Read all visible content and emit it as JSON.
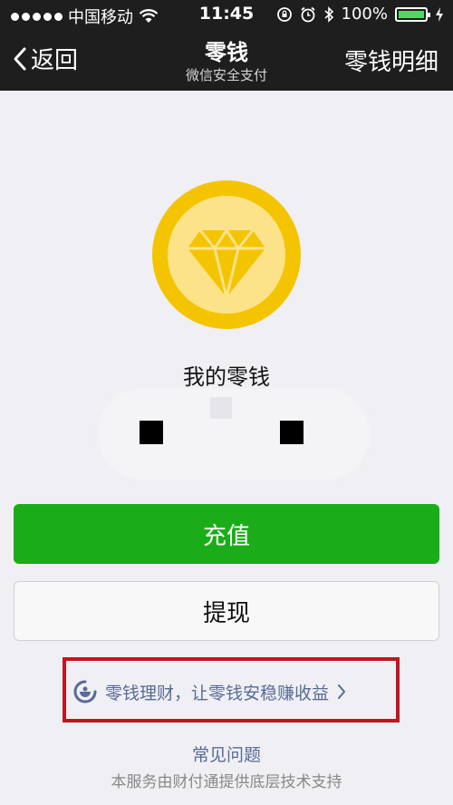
{
  "status_bar": {
    "carrier": "中国移动",
    "time": "11:45",
    "battery": "100%",
    "battery_level": 1.0
  },
  "nav": {
    "back_label": "返回",
    "title": "零钱",
    "subtitle": "微信安全支付",
    "details_label": "零钱明细"
  },
  "wallet": {
    "balance_label": "我的零钱"
  },
  "actions": {
    "recharge_label": "充值",
    "withdraw_label": "提现"
  },
  "promo": {
    "text": "零钱理财，让零钱安稳赚收益"
  },
  "footer": {
    "faq_label": "常见问题",
    "note": "本服务由财付通提供底层技术支持"
  },
  "colors": {
    "primary_green": "#1aad19",
    "link_blue": "#576b95",
    "coin_gold": "#f5c400",
    "highlight_red": "#c2161e"
  }
}
